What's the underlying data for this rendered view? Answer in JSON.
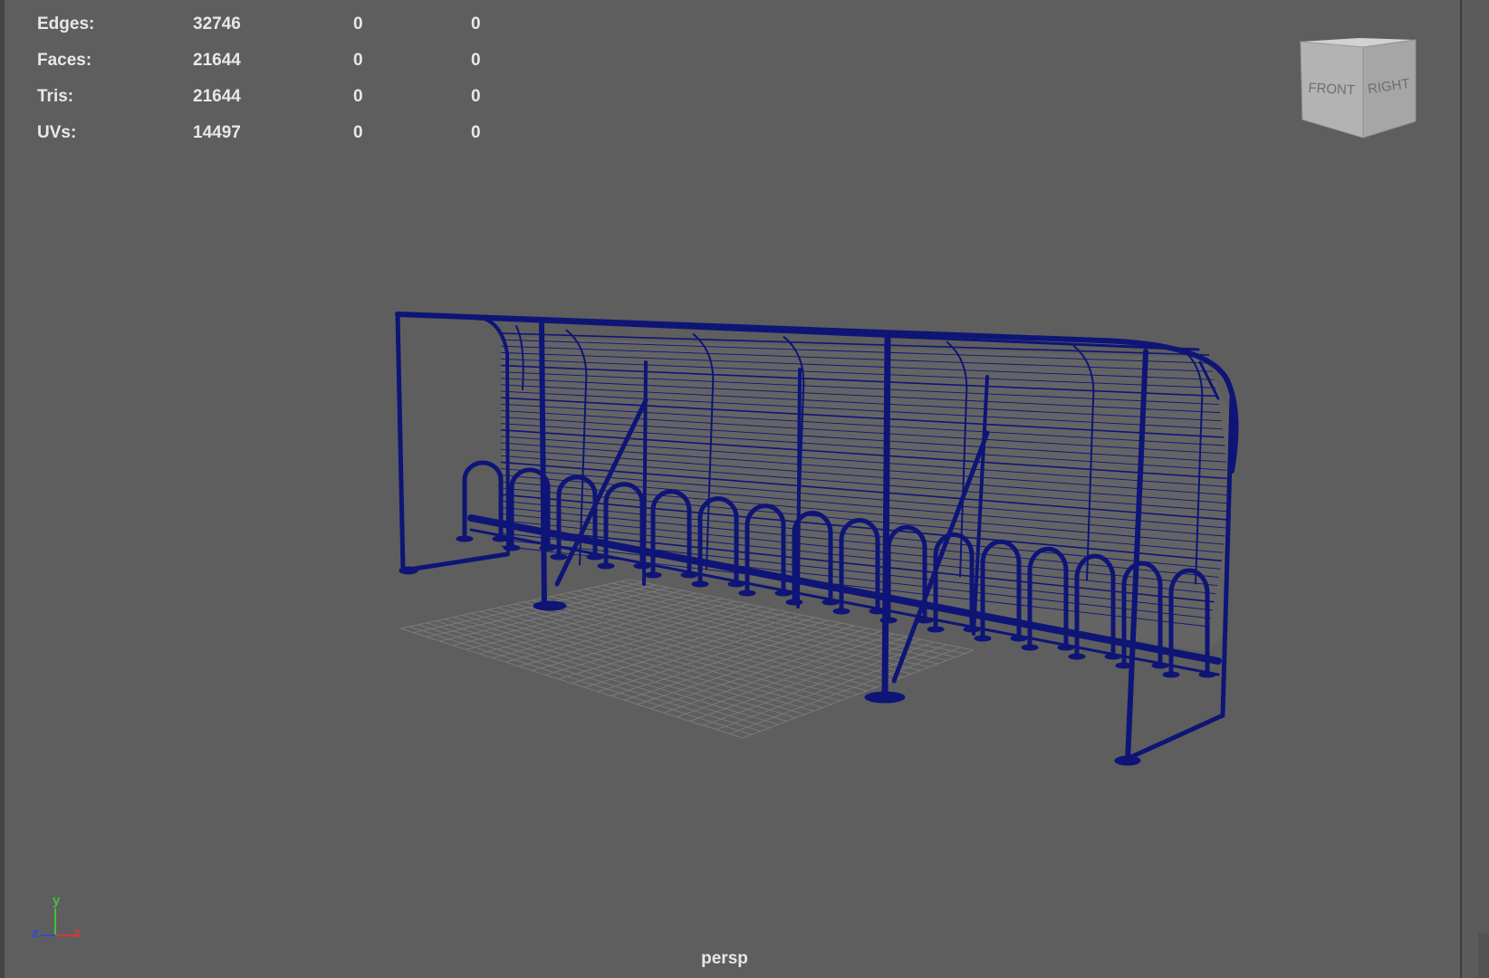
{
  "hud": {
    "rows": [
      {
        "label": "Edges:",
        "v1": "32746",
        "v2": "0",
        "v3": "0"
      },
      {
        "label": "Faces:",
        "v1": "21644",
        "v2": "0",
        "v3": "0"
      },
      {
        "label": "Tris:",
        "v1": "21644",
        "v2": "0",
        "v3": "0"
      },
      {
        "label": "UVs:",
        "v1": "14497",
        "v2": "0",
        "v3": "0"
      }
    ]
  },
  "viewcube": {
    "front": "FRONT",
    "right": "RIGHT"
  },
  "axis": {
    "y": "y",
    "z": "z",
    "x": "x"
  },
  "camera": "persp",
  "colors": {
    "wire": "#0e1576",
    "viewport_bg": "#5e5e5e",
    "grid": "#7a7a7a"
  }
}
